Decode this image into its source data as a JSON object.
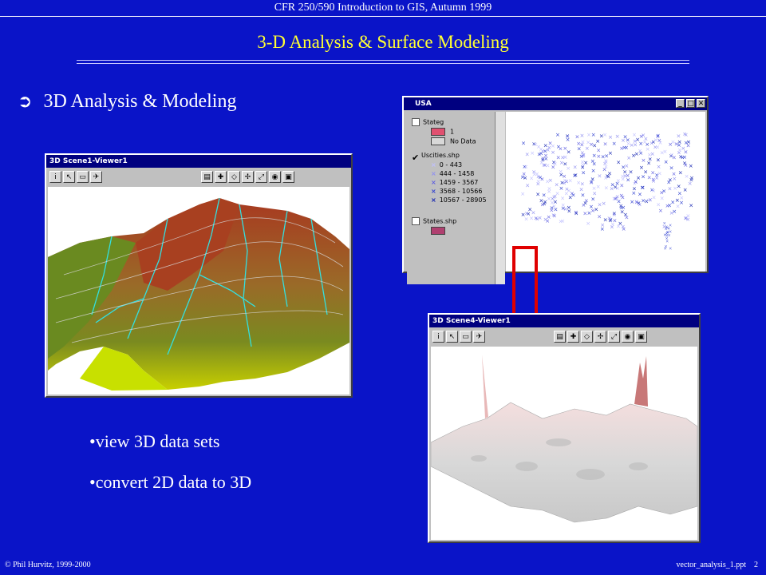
{
  "header": {
    "course": "CFR 250/590 Introduction to GIS, Autumn 1999",
    "title": "3-D Analysis & Surface Modeling"
  },
  "main_bullet": {
    "glyph": "➲",
    "text": "3D Analysis & Modeling"
  },
  "sub_bullets": [
    "•view 3D data sets",
    "•convert 2D data to 3D"
  ],
  "windows": {
    "scene1": {
      "title": "3D Scene1-Viewer1"
    },
    "usa": {
      "title": "USA",
      "legend": {
        "theme1": "Stateg",
        "theme1_items": [
          "1",
          "No Data"
        ],
        "theme2": "Uscities.shp",
        "theme2_items": [
          "0 - 443",
          "444 - 1458",
          "1459 - 3567",
          "3568 - 10566",
          "10567 - 28905"
        ],
        "theme3": "States.shp"
      }
    },
    "scene4": {
      "title": "3D Scene4-Viewer1"
    }
  },
  "footer": {
    "left": "© Phil Hurvitz, 1999-2000",
    "right": "vector_analysis_1.ppt    2"
  },
  "colors": {
    "background": "#0a14c8",
    "title": "#ffff33",
    "arrow": "#e00000"
  }
}
